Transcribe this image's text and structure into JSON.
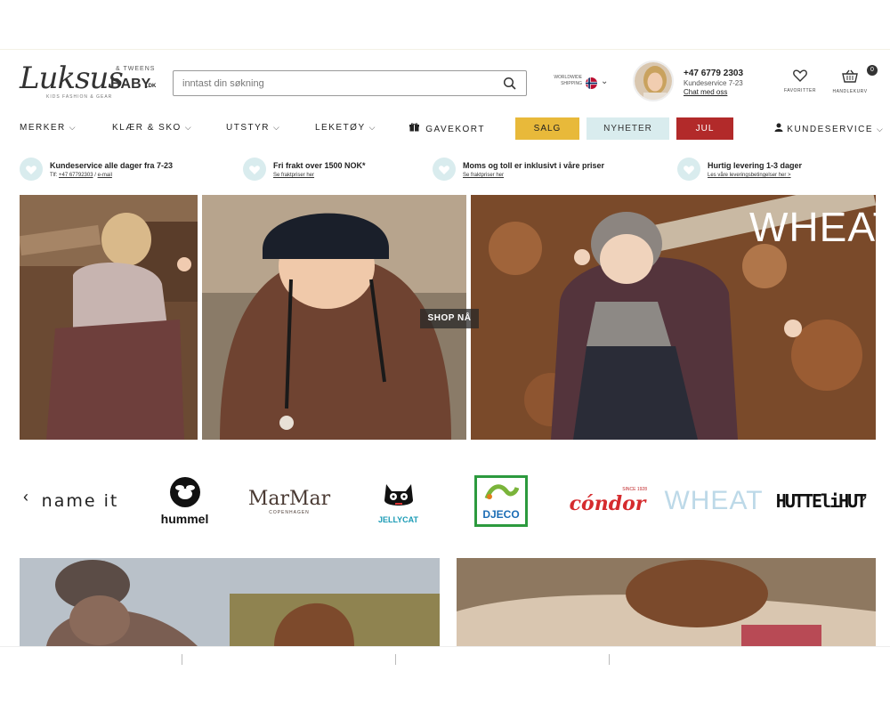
{
  "logo": {
    "script": "Luksus",
    "baby": "BABY",
    "dk": ".DK",
    "tweens": "& TWEENS",
    "tagline": "KIDS FASHION & GEAR"
  },
  "search": {
    "placeholder": "inntast din søkning"
  },
  "shipping": {
    "line1": "WORLDWIDE",
    "line2": "SHIPPING"
  },
  "contact": {
    "phone": "+47 6779 2303",
    "hours": "Kundeservice 7-23",
    "chat": "Chat med oss"
  },
  "header_icons": {
    "favorites": "FAVORITTER",
    "cart": "HANDLEKURV",
    "cart_count": "0"
  },
  "nav": {
    "items": [
      {
        "label": "MERKER"
      },
      {
        "label": "KLÆR & SKO"
      },
      {
        "label": "UTSTYR"
      },
      {
        "label": "LEKETØY"
      }
    ],
    "giftcard": "GAVEKORT",
    "sale": "SALG",
    "news": "NYHETER",
    "christmas": "JUL",
    "customer_service": "KUNDESERVICE"
  },
  "usp": [
    {
      "title": "Kundeservice alle dager fra 7-23",
      "sub_prefix": "Tlf: ",
      "sub_phone": "+47 67792303",
      "sub_sep": " / ",
      "sub_email": "e-mail"
    },
    {
      "title": "Fri frakt over 1500 NOK*",
      "sub": "Se fraktpriser her"
    },
    {
      "title": "Moms og toll er inklusivt i våre priser",
      "sub": "Se fraktpriser her"
    },
    {
      "title": "Hurtig levering 1-3 dager",
      "sub": "Les våre leveringsbetingelser her >"
    }
  ],
  "hero": {
    "cta": "SHOP NÅ",
    "brand_overlay": "WHEAT"
  },
  "brands": [
    "name it",
    "hummel",
    "MarMar",
    "JELLYCAT",
    "DJECO",
    "cóndor",
    "WHEAT",
    "HUTTEliHUT"
  ],
  "brand_sub": {
    "marmar": "COPENHAGEN",
    "condor": "SINCE 1928"
  },
  "colors": {
    "sale": "#e8b93a",
    "news": "#d9ecee",
    "christmas": "#b22a2a",
    "usp_circle": "#d9ecee"
  }
}
